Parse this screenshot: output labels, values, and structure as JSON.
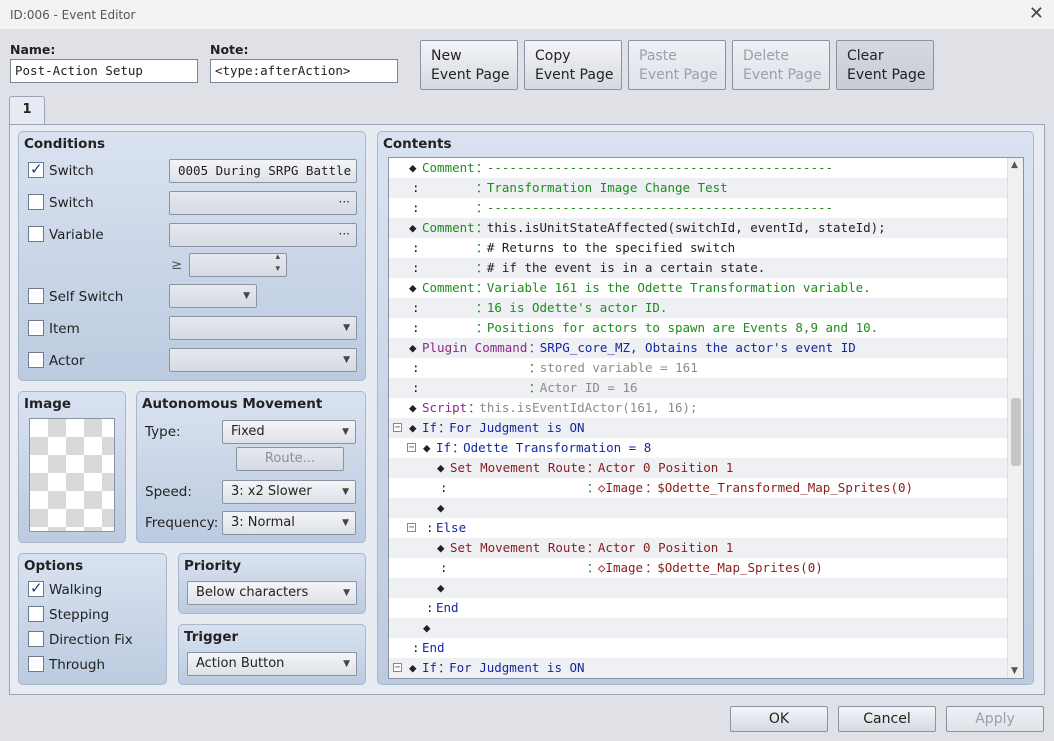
{
  "window": {
    "title": "ID:006 - Event Editor",
    "close": "✕"
  },
  "header": {
    "name_label": "Name:",
    "name_value": "Post-Action Setup",
    "note_label": "Note:",
    "note_value": "<type:afterAction>",
    "buttons": {
      "new": [
        "New",
        "Event Page"
      ],
      "copy": [
        "Copy",
        "Event Page"
      ],
      "paste": [
        "Paste",
        "Event Page"
      ],
      "delete": [
        "Delete",
        "Event Page"
      ],
      "clear": [
        "Clear",
        "Event Page"
      ]
    }
  },
  "tab": {
    "label": "1"
  },
  "conditions": {
    "title": "Conditions",
    "switch1": {
      "label": "Switch",
      "checked": true,
      "value": "0005 During SRPG Battle"
    },
    "switch2": {
      "label": "Switch",
      "checked": false
    },
    "variable": {
      "label": "Variable",
      "checked": false,
      "op": "≥"
    },
    "self_switch": {
      "label": "Self Switch",
      "checked": false
    },
    "item": {
      "label": "Item",
      "checked": false
    },
    "actor": {
      "label": "Actor",
      "checked": false
    }
  },
  "image": {
    "title": "Image"
  },
  "movement": {
    "title": "Autonomous Movement",
    "type_label": "Type:",
    "type_value": "Fixed",
    "route_button": "Route...",
    "speed_label": "Speed:",
    "speed_value": "3: x2 Slower",
    "freq_label": "Frequency:",
    "freq_value": "3: Normal"
  },
  "options": {
    "title": "Options",
    "walking": {
      "label": "Walking",
      "checked": true
    },
    "stepping": {
      "label": "Stepping",
      "checked": false
    },
    "direction_fix": {
      "label": "Direction Fix",
      "checked": false
    },
    "through": {
      "label": "Through",
      "checked": false
    }
  },
  "priority": {
    "title": "Priority",
    "value": "Below characters"
  },
  "trigger": {
    "title": "Trigger",
    "value": "Action Button"
  },
  "contents": {
    "title": "Contents",
    "rows": [
      {
        "indent": 20,
        "diamond": true,
        "cmd": "Comment",
        "sep": "：",
        "cmd_color": "green",
        "text": "----------------------------------------------",
        "text_color": "green"
      },
      {
        "indent": 20,
        "prefix": ":",
        "sep": "：",
        "text": "Transformation Image Change Test",
        "text_color": "green"
      },
      {
        "indent": 20,
        "prefix": ":",
        "sep": "：",
        "text": "----------------------------------------------",
        "text_color": "green"
      },
      {
        "indent": 20,
        "diamond": true,
        "cmd": "Comment",
        "sep": "：",
        "cmd_color": "green",
        "text": "this.isUnitStateAffected(switchId, eventId, stateId);",
        "text_color": "black"
      },
      {
        "indent": 20,
        "prefix": ":",
        "sep": "：",
        "text": "# Returns to the specified switch",
        "text_color": "black"
      },
      {
        "indent": 20,
        "prefix": ":",
        "sep": "：",
        "text": "# if the event is in a certain state.",
        "text_color": "black"
      },
      {
        "indent": 20,
        "diamond": true,
        "cmd": "Comment",
        "sep": "：",
        "cmd_color": "green",
        "text": "Variable 161 is the Odette Transformation variable.",
        "text_color": "green"
      },
      {
        "indent": 20,
        "prefix": ":",
        "sep": "：",
        "text": "16 is Odette's actor ID.",
        "text_color": "green"
      },
      {
        "indent": 20,
        "prefix": ":",
        "sep": "：",
        "text": "Positions for actors to spawn are Events 8,9 and 10.",
        "text_color": "green"
      },
      {
        "indent": 20,
        "diamond": true,
        "cmd": "Plugin Command",
        "sep": "：",
        "cmd_color": "purple",
        "text": "SRPG_core_MZ, Obtains the actor's event ID",
        "text_color": "blue",
        "wide": true
      },
      {
        "indent": 20,
        "prefix": ":",
        "sep": "：",
        "text": "stored variable = 161",
        "text_color": "gray",
        "wide": true
      },
      {
        "indent": 20,
        "prefix": ":",
        "sep": "：",
        "text": "Actor ID = 16",
        "text_color": "gray",
        "wide": true
      },
      {
        "indent": 20,
        "diamond": true,
        "cmd": "Script",
        "sep": "：",
        "cmd_color": "purple",
        "text": "this.isEventIdActor(161, 16);",
        "text_color": "gray"
      },
      {
        "indent": 20,
        "fold": true,
        "diamond": true,
        "cmd": "If",
        "sep": "：",
        "cmd_color": "blue",
        "text": "For Judgment is ON",
        "text_color": "blue"
      },
      {
        "indent": 34,
        "fold": true,
        "diamond": true,
        "cmd": "If",
        "sep": "：",
        "cmd_color": "blue",
        "text": "Odette Transformation = 8",
        "text_color": "blue"
      },
      {
        "indent": 48,
        "diamond": true,
        "cmd": "Set Movement Route",
        "sep": "：",
        "cmd_color": "red",
        "text": "Actor 0 Position 1",
        "text_color": "red"
      },
      {
        "indent": 48,
        "prefix": ":",
        "sep": "：",
        "sub": "◇Image",
        "sub_color": "red",
        "text": "$Odette_Transformed_Map_Sprites(0)",
        "text_color": "red"
      },
      {
        "indent": 48,
        "diamond": true
      },
      {
        "indent": 34,
        "fold": true,
        "prefix": ":",
        "cmd": "Else",
        "cmd_color": "blue"
      },
      {
        "indent": 48,
        "diamond": true,
        "cmd": "Set Movement Route",
        "sep": "：",
        "cmd_color": "red",
        "text": "Actor 0 Position 1",
        "text_color": "red"
      },
      {
        "indent": 48,
        "prefix": ":",
        "sep": "：",
        "sub": "◇Image",
        "sub_color": "red",
        "text": "$Odette_Map_Sprites(0)",
        "text_color": "red"
      },
      {
        "indent": 48,
        "diamond": true
      },
      {
        "indent": 34,
        "prefix": ":",
        "cmd": "End",
        "cmd_color": "blue"
      },
      {
        "indent": 34,
        "diamond": true
      },
      {
        "indent": 20,
        "prefix": ":",
        "cmd": "End",
        "cmd_color": "blue"
      },
      {
        "indent": 20,
        "fold": true,
        "diamond": true,
        "cmd": "If",
        "sep": "：",
        "cmd_color": "blue",
        "text": "For Judgment is ON",
        "text_color": "blue"
      }
    ]
  },
  "footer": {
    "ok": "OK",
    "cancel": "Cancel",
    "apply": "Apply"
  },
  "colors": {
    "green": "#1e8c1e",
    "blue": "#1428a0",
    "purple": "#8a2a8a",
    "gray": "#8b8b8b",
    "red": "#8a1c1c",
    "black": "#222222"
  }
}
